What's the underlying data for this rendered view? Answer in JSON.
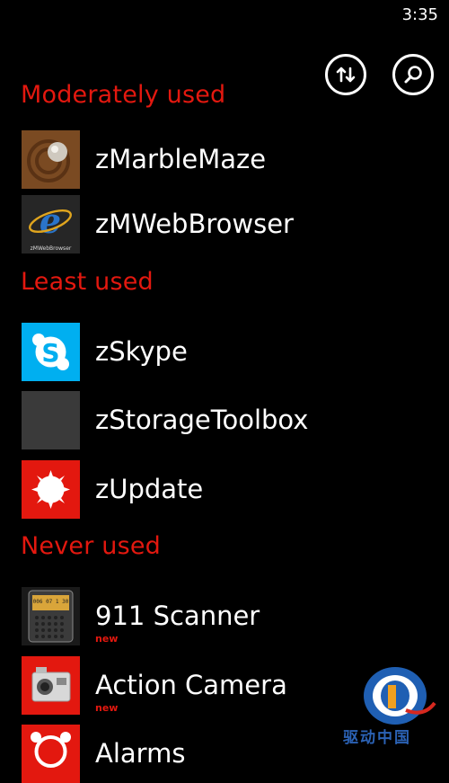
{
  "status": {
    "time": "3:35"
  },
  "toolbar": {
    "sort_icon": "sort-arrows-icon",
    "search_icon": "search-icon"
  },
  "sections": [
    {
      "title": "Moderately used"
    },
    {
      "title": "Least used"
    },
    {
      "title": "Never used"
    }
  ],
  "apps": {
    "moderately": [
      {
        "name": "zMarbleMaze",
        "icon": "marble-maze-icon"
      },
      {
        "name": "zMWebBrowser",
        "icon": "web-browser-icon",
        "tile_caption": "zMWebBrowser"
      }
    ],
    "least": [
      {
        "name": "zSkype",
        "icon": "skype-icon"
      },
      {
        "name": "zStorageToolbox",
        "icon": "storage-toolbox-icon"
      },
      {
        "name": "zUpdate",
        "icon": "update-icon"
      }
    ],
    "never": [
      {
        "name": "911 Scanner",
        "badge": "new",
        "icon": "scanner-radio-icon",
        "display": "006 07 1 30"
      },
      {
        "name": "Action Camera",
        "badge": "new",
        "icon": "action-camera-icon"
      },
      {
        "name": "Alarms",
        "icon": "alarm-clock-icon"
      }
    ]
  },
  "watermark": {
    "text": "驱动中国"
  },
  "colors": {
    "accent": "#e3180f",
    "background": "#000000",
    "text": "#ffffff",
    "skype": "#00aff0"
  }
}
